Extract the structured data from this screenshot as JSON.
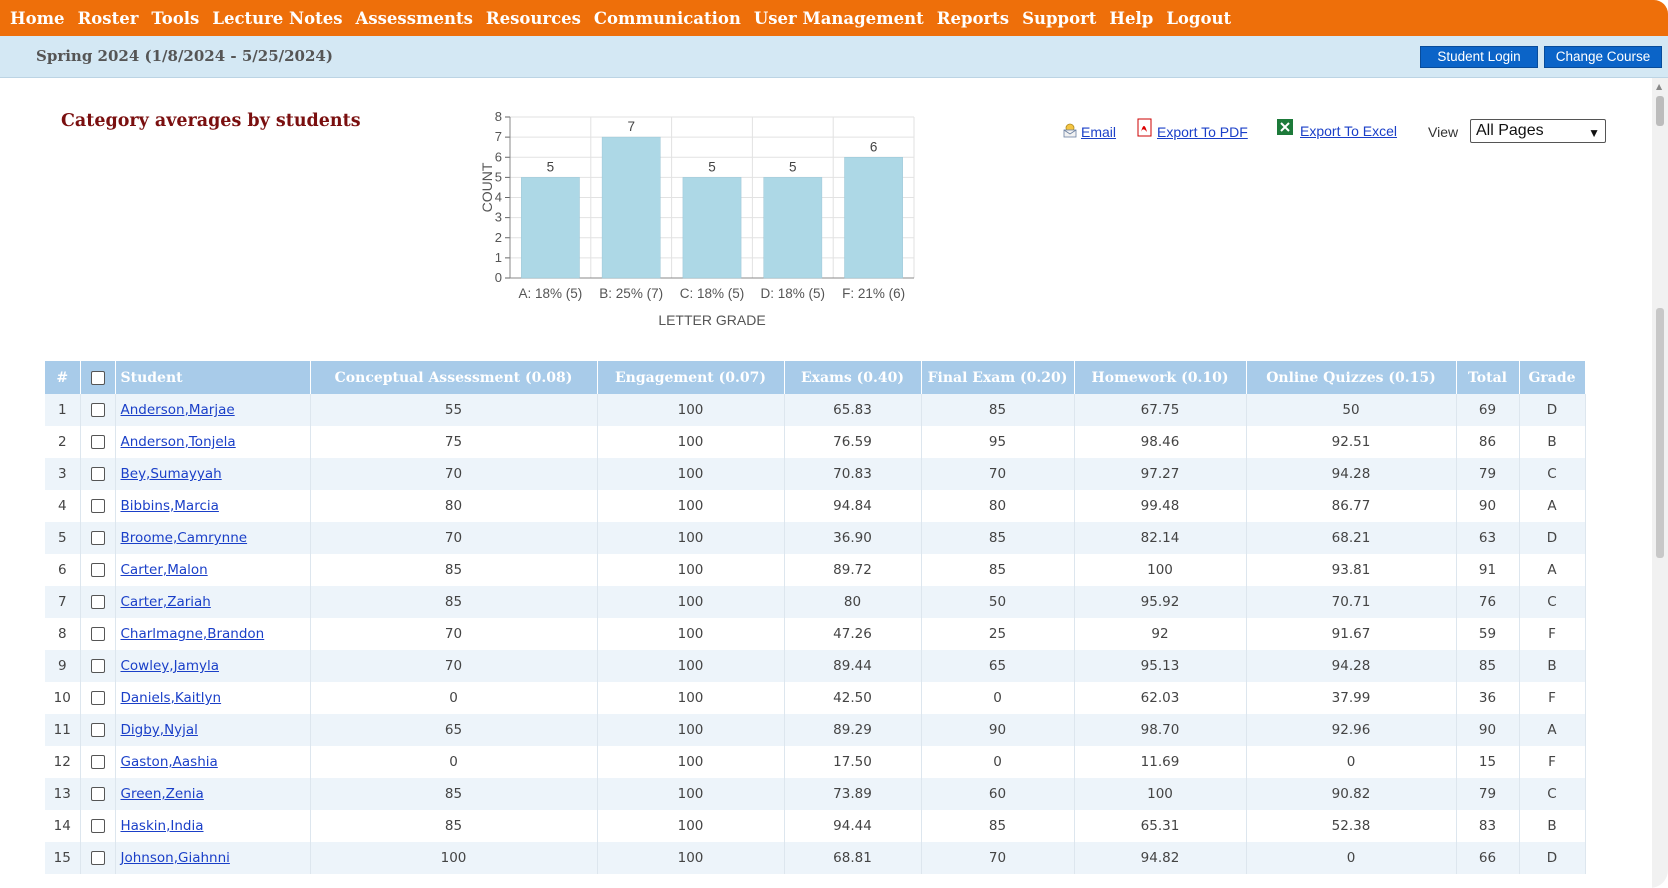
{
  "nav": {
    "items": [
      "Home",
      "Roster",
      "Tools",
      "Lecture Notes",
      "Assessments",
      "Resources",
      "Communication",
      "User Management",
      "Reports",
      "Support",
      "Help",
      "Logout"
    ]
  },
  "header": {
    "term": "Spring 2024 (1/8/2024 - 5/25/2024)",
    "student_login": "Student Login",
    "change_course": "Change Course"
  },
  "page": {
    "title": "Category averages by students"
  },
  "exports": {
    "email": "Email",
    "pdf": "Export To PDF",
    "excel": "Export To Excel",
    "view_label": "View",
    "view_selected": "All Pages"
  },
  "chart_data": {
    "type": "bar",
    "categories": [
      "A: 18% (5)",
      "B: 25% (7)",
      "C: 18% (5)",
      "D: 18% (5)",
      "F: 21% (6)"
    ],
    "values": [
      5,
      7,
      5,
      5,
      6
    ],
    "xlabel": "LETTER GRADE",
    "ylabel": "COUNT",
    "ylim": [
      0,
      8
    ],
    "yticks": [
      0,
      1,
      2,
      3,
      4,
      5,
      6,
      7,
      8
    ],
    "grid": true,
    "bar_color": "#add8e6"
  },
  "table": {
    "headers": [
      "#",
      "",
      "Student",
      "Conceptual Assessment (0.08)",
      "Engagement (0.07)",
      "Exams (0.40)",
      "Final Exam (0.20)",
      "Homework (0.10)",
      "Online Quizzes (0.15)",
      "Total",
      "Grade"
    ],
    "rows": [
      [
        "1",
        "Anderson,Marjae",
        "55",
        "100",
        "65.83",
        "85",
        "67.75",
        "50",
        "69",
        "D"
      ],
      [
        "2",
        "Anderson,Tonjela",
        "75",
        "100",
        "76.59",
        "95",
        "98.46",
        "92.51",
        "86",
        "B"
      ],
      [
        "3",
        "Bey,Sumayyah",
        "70",
        "100",
        "70.83",
        "70",
        "97.27",
        "94.28",
        "79",
        "C"
      ],
      [
        "4",
        "Bibbins,Marcia",
        "80",
        "100",
        "94.84",
        "80",
        "99.48",
        "86.77",
        "90",
        "A"
      ],
      [
        "5",
        "Broome,Camrynne",
        "70",
        "100",
        "36.90",
        "85",
        "82.14",
        "68.21",
        "63",
        "D"
      ],
      [
        "6",
        "Carter,Malon",
        "85",
        "100",
        "89.72",
        "85",
        "100",
        "93.81",
        "91",
        "A"
      ],
      [
        "7",
        "Carter,Zariah",
        "85",
        "100",
        "80",
        "50",
        "95.92",
        "70.71",
        "76",
        "C"
      ],
      [
        "8",
        "Charlmagne,Brandon",
        "70",
        "100",
        "47.26",
        "25",
        "92",
        "91.67",
        "59",
        "F"
      ],
      [
        "9",
        "Cowley,Jamyla",
        "70",
        "100",
        "89.44",
        "65",
        "95.13",
        "94.28",
        "85",
        "B"
      ],
      [
        "10",
        "Daniels,Kaitlyn",
        "0",
        "100",
        "42.50",
        "0",
        "62.03",
        "37.99",
        "36",
        "F"
      ],
      [
        "11",
        "Digby,Nyjal",
        "65",
        "100",
        "89.29",
        "90",
        "98.70",
        "92.96",
        "90",
        "A"
      ],
      [
        "12",
        "Gaston,Aashia",
        "0",
        "100",
        "17.50",
        "0",
        "11.69",
        "0",
        "15",
        "F"
      ],
      [
        "13",
        "Green,Zenia",
        "85",
        "100",
        "73.89",
        "60",
        "100",
        "90.82",
        "79",
        "C"
      ],
      [
        "14",
        "Haskin,India",
        "85",
        "100",
        "94.44",
        "85",
        "65.31",
        "52.38",
        "83",
        "B"
      ],
      [
        "15",
        "Johnson,Giahnni",
        "100",
        "100",
        "68.81",
        "70",
        "94.82",
        "0",
        "66",
        "D"
      ]
    ]
  },
  "colors": {
    "nav_bg": "#ee6f0a",
    "subbar_bg": "#d4e8f4",
    "header_bg": "#a8cbe9",
    "title_color": "#7a0f0f",
    "link_color": "#1a3fc8"
  }
}
